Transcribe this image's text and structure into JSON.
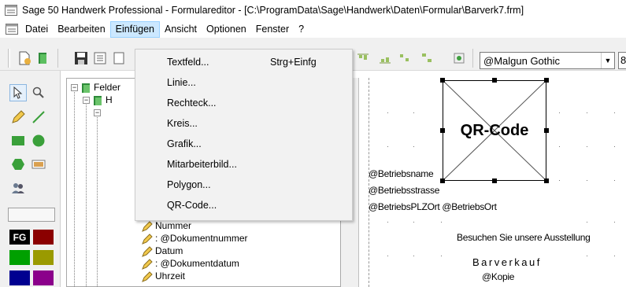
{
  "window": {
    "title": "Sage 50 Handwerk Professional - Formulareditor - [C:\\ProgramData\\Sage\\Handwerk\\Daten\\Formular\\Barverk7.frm]"
  },
  "menubar": {
    "items": [
      {
        "label": "Datei"
      },
      {
        "label": "Bearbeiten"
      },
      {
        "label": "Einfügen"
      },
      {
        "label": "Ansicht"
      },
      {
        "label": "Optionen"
      },
      {
        "label": "Fenster"
      },
      {
        "label": "?"
      }
    ]
  },
  "toolbar": {
    "font_name": "@Malgun Gothic",
    "font_size": "8"
  },
  "insert_menu": {
    "items": [
      {
        "label": "Textfeld...",
        "shortcut": "Strg+Einfg"
      },
      {
        "label": "Linie..."
      },
      {
        "label": "Rechteck..."
      },
      {
        "label": "Kreis..."
      },
      {
        "label": "Grafik..."
      },
      {
        "label": "Mitarbeiterbild..."
      },
      {
        "label": "Polygon..."
      },
      {
        "label": "QR-Code..."
      }
    ]
  },
  "tree": {
    "root_label": "Felder",
    "child_label": "H",
    "items": [
      {
        "label": "Nummer"
      },
      {
        "label": ": @Dokumentnummer"
      },
      {
        "label": "Datum"
      },
      {
        "label": ": @Dokumentdatum"
      },
      {
        "label": "Uhrzeit"
      }
    ]
  },
  "palette": {
    "fg_label": "FG",
    "colors": [
      "#8b0000",
      "#00a000",
      "#9a9a00",
      "#000090",
      "#8b008b"
    ]
  },
  "canvas": {
    "qr_label": "QR-Code",
    "fields": [
      {
        "text": "@Betriebsname"
      },
      {
        "text": "@Betriebsstrasse"
      },
      {
        "text": "@BetriebsPLZOrt @BetriebsOrt"
      },
      {
        "text": "Besuchen Sie unsere Ausstellung"
      },
      {
        "text": "Barverkauf"
      },
      {
        "text": "@Kopie"
      }
    ]
  }
}
